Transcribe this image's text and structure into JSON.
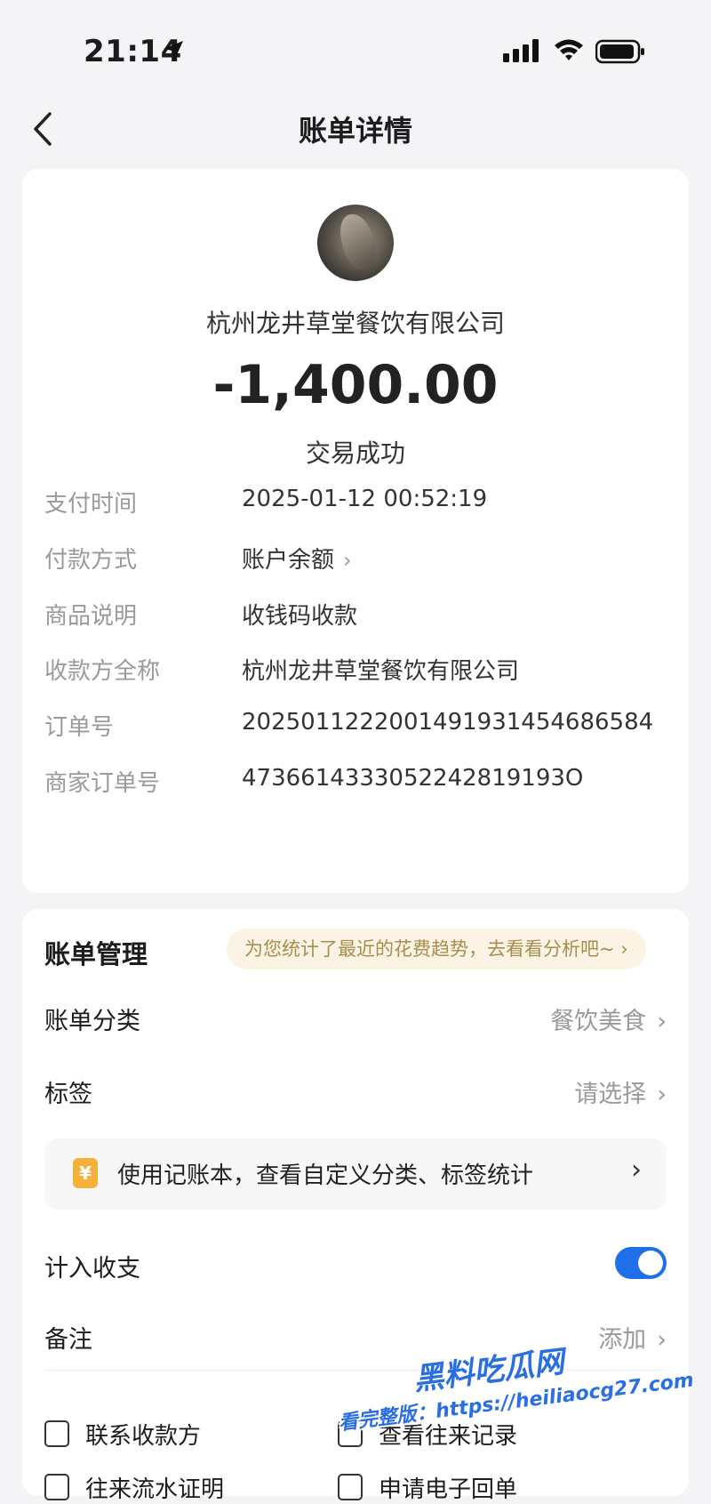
{
  "status_bar": {
    "time": "21:14",
    "icons": [
      "location-arrow-icon",
      "signal-icon",
      "wifi-icon",
      "battery-icon"
    ]
  },
  "nav": {
    "back_icon": "chevron-left-icon",
    "title": "账单详情"
  },
  "summary": {
    "merchant_name": "杭州龙井草堂餐饮有限公司",
    "amount": "-1,400.00",
    "status": "交易成功"
  },
  "details": [
    {
      "label": "支付时间",
      "value": "2025-01-12 00:52:19"
    },
    {
      "label": "付款方式",
      "value": "账户余额"
    },
    {
      "label": "商品说明",
      "value": "收钱码收款"
    },
    {
      "label": "收款方全称",
      "value": "杭州龙井草堂餐饮有限公司"
    },
    {
      "label": "订单号",
      "value": "2025011222001491931454686584"
    },
    {
      "label": "商家订单号",
      "value": "4736614333052242819193O"
    }
  ],
  "management": {
    "title": "账单管理",
    "tip": "为您统计了最近的花费趋势，去看看分析吧~",
    "category": {
      "label": "账单分类",
      "value": "餐饮美食"
    },
    "tags": {
      "label": "标签",
      "value": "请选择"
    },
    "promo": {
      "icon": "ledger-icon",
      "icon_glyph": "¥",
      "text": "使用记账本，查看自定义分类、标签统计"
    },
    "include": {
      "label": "计入收支",
      "enabled": true
    },
    "note": {
      "label": "备注",
      "value": "添加"
    },
    "actions": [
      {
        "icon": "contact-icon",
        "label": "联系收款方"
      },
      {
        "icon": "document-icon",
        "label": "查看往来记录"
      },
      {
        "icon": "statement-icon",
        "label": "往来流水证明"
      },
      {
        "icon": "receipt-icon",
        "label": "申请电子回单"
      }
    ]
  },
  "watermark": {
    "title": "黑料吃瓜网",
    "url": "看完整版：https://heiliaocg27.com"
  },
  "colors": {
    "accent": "#1f6fe8",
    "tip_bg": "#fbf3e3",
    "tip_text": "#a98d4e",
    "promo_icon": "#f4b23d"
  }
}
